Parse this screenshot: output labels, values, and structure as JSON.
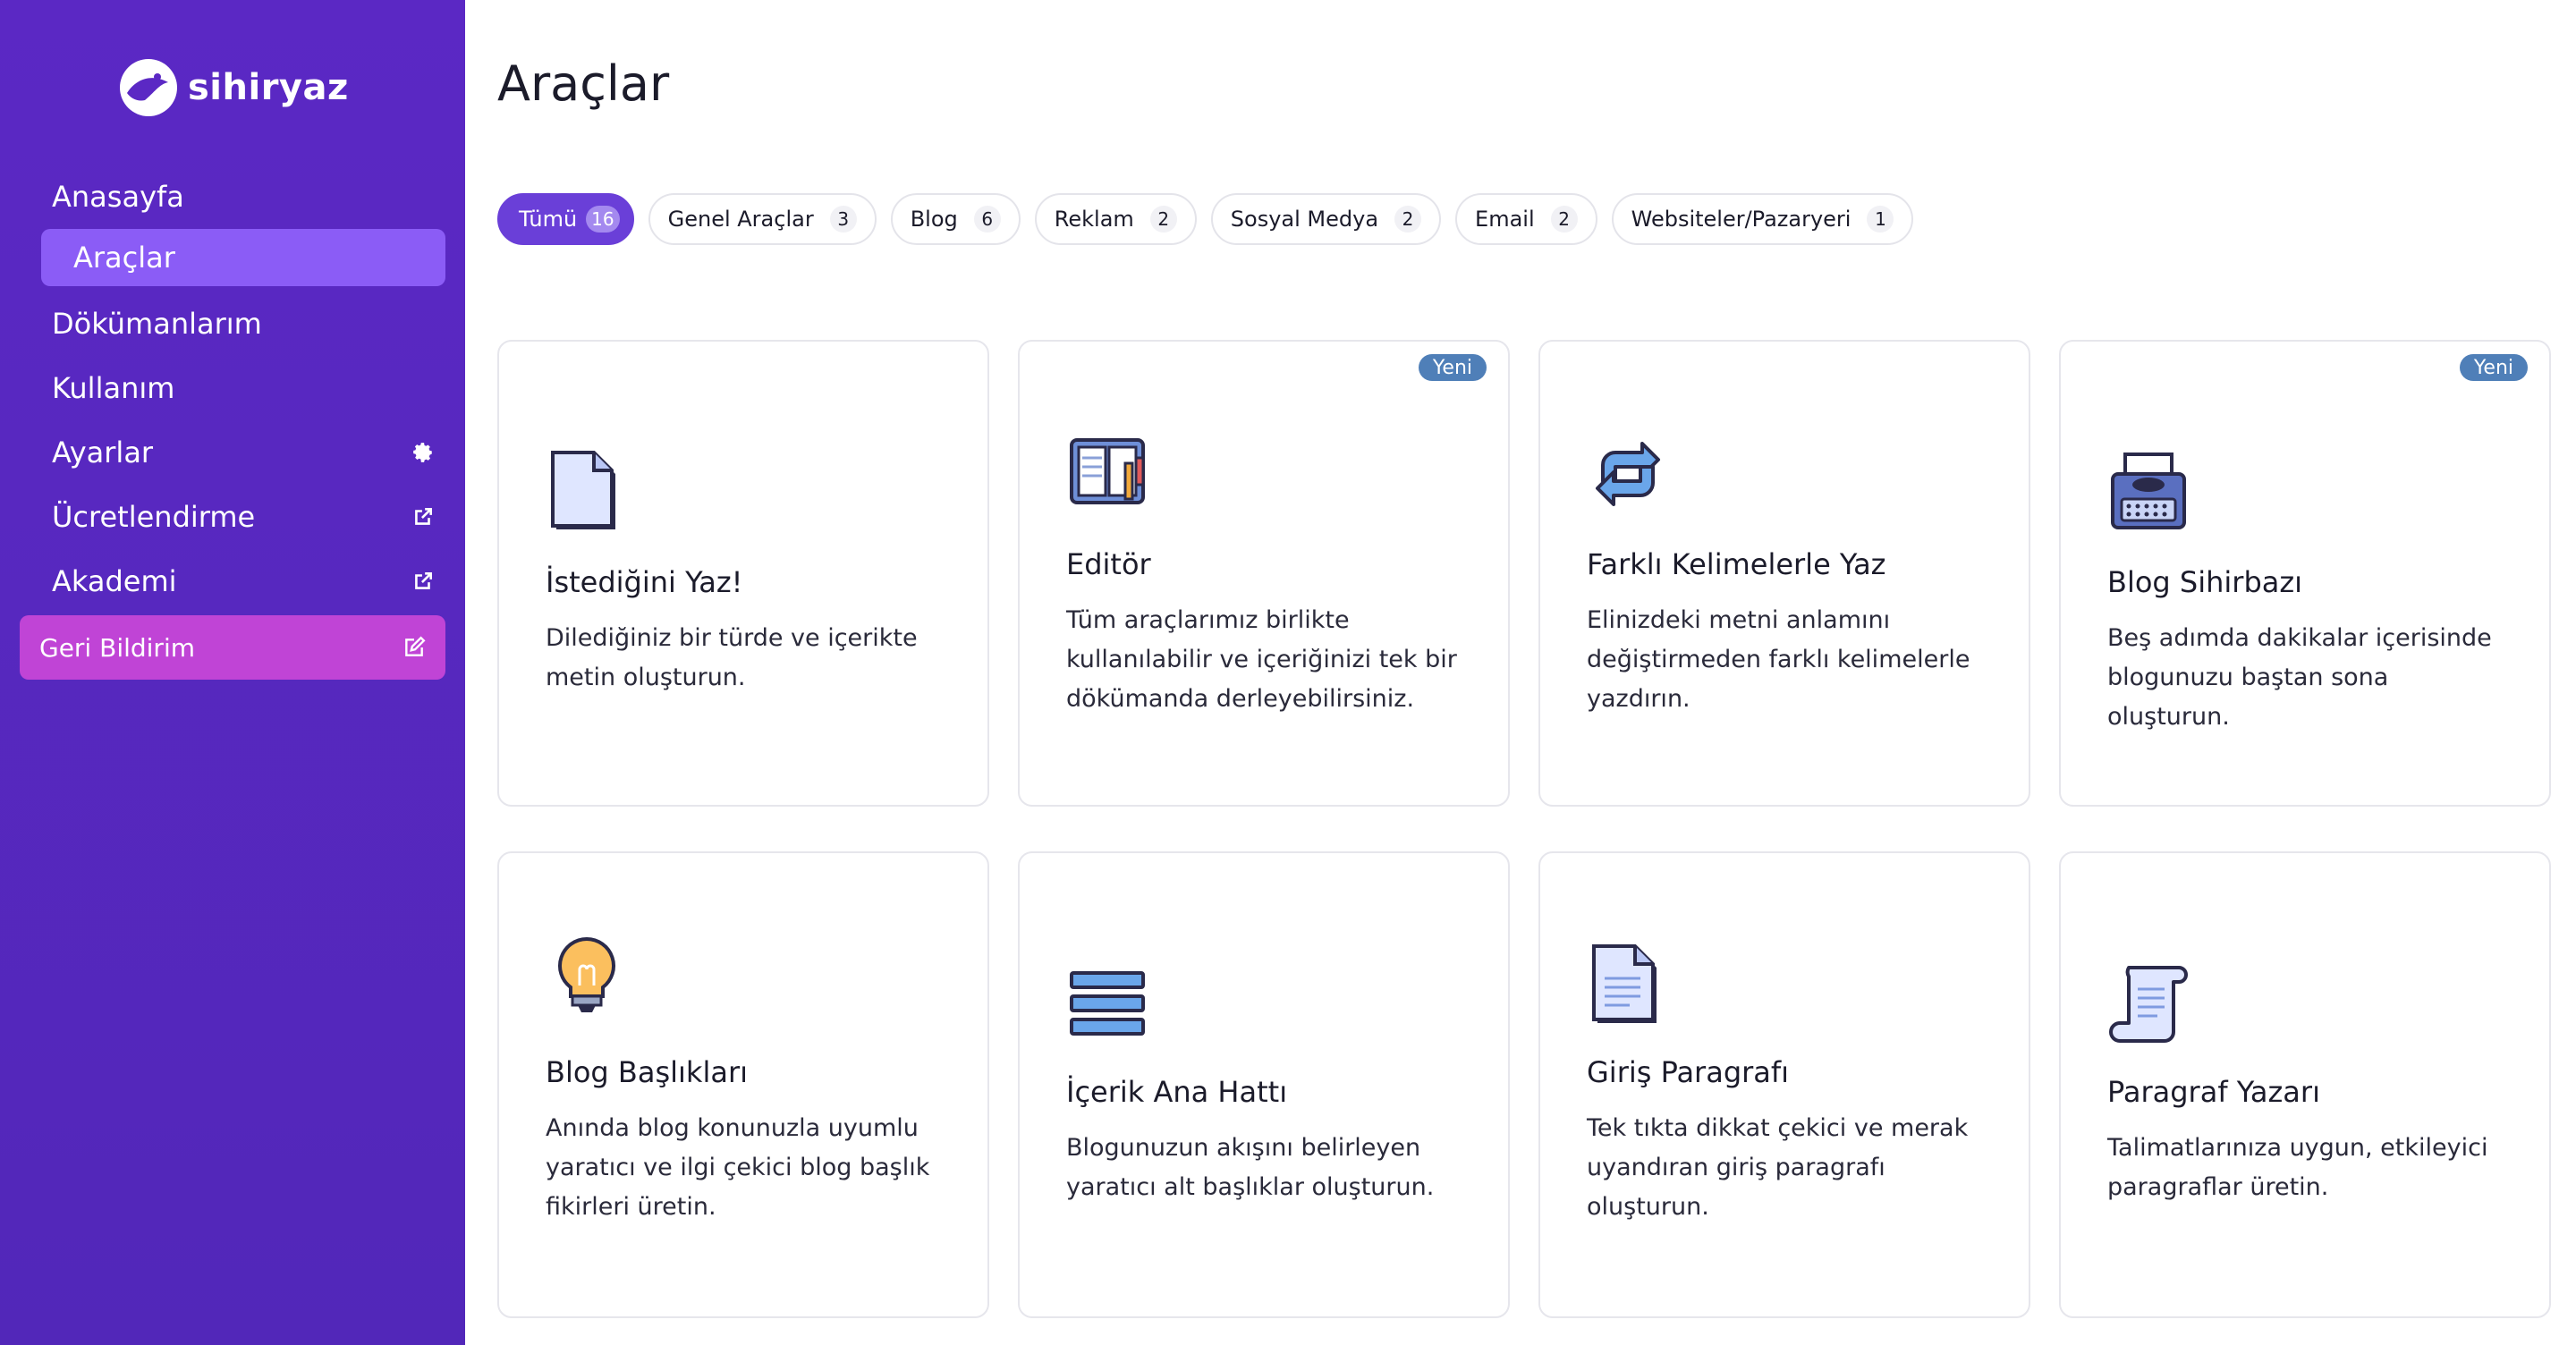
{
  "brand": {
    "name": "sihiryaz"
  },
  "sidebar": {
    "items": [
      {
        "label": "Anasayfa",
        "icon": ""
      },
      {
        "label": "Araçlar",
        "icon": ""
      },
      {
        "label": "Dökümanlarım",
        "icon": ""
      },
      {
        "label": "Kullanım",
        "icon": ""
      },
      {
        "label": "Ayarlar",
        "icon": "gear-icon"
      },
      {
        "label": "Ücretlendirme",
        "icon": "external-link-icon"
      },
      {
        "label": "Akademi",
        "icon": "external-link-icon"
      }
    ],
    "feedback": {
      "label": "Geri Bildirim",
      "icon": "edit-icon"
    }
  },
  "page": {
    "title": "Araçlar"
  },
  "filters": [
    {
      "label": "Tümü",
      "count": "16"
    },
    {
      "label": "Genel Araçlar",
      "count": "3"
    },
    {
      "label": "Blog",
      "count": "6"
    },
    {
      "label": "Reklam",
      "count": "2"
    },
    {
      "label": "Sosyal Medya",
      "count": "2"
    },
    {
      "label": "Email",
      "count": "2"
    },
    {
      "label": "Websiteler/Pazaryeri",
      "count": "1"
    }
  ],
  "cards": [
    {
      "title": "İstediğini Yaz!",
      "desc": "Dilediğiniz bir türde ve içerikte metin oluşturun.",
      "badge": "",
      "icon": "document-icon"
    },
    {
      "title": "Editör",
      "desc": "Tüm araçlarımız birlikte kullanılabilir ve içeriğinizi tek bir dökümanda derleyebilirsiniz.",
      "badge": "Yeni",
      "icon": "notebook-icon"
    },
    {
      "title": "Farklı Kelimelerle Yaz",
      "desc": "Elinizdeki metni anlamını değiştirmeden farklı kelimelerle yazdırın.",
      "badge": "",
      "icon": "repeat-icon"
    },
    {
      "title": "Blog Sihirbazı",
      "desc": "Beş adımda dakikalar içerisinde blogunuzu baştan sona oluşturun.",
      "badge": "Yeni",
      "icon": "typewriter-icon"
    },
    {
      "title": "Blog Başlıkları",
      "desc": "Anında blog konunuzla uyumlu yaratıcı ve ilgi çekici blog başlık fikirleri üretin.",
      "badge": "",
      "icon": "lightbulb-icon"
    },
    {
      "title": "İçerik Ana Hattı",
      "desc": "Blogunuzun akışını belirleyen yaratıcı alt başlıklar oluşturun.",
      "badge": "",
      "icon": "list-icon"
    },
    {
      "title": "Giriş Paragrafı",
      "desc": "Tek tıkta dikkat çekici ve merak uyandıran giriş paragrafı oluşturun.",
      "badge": "",
      "icon": "text-document-icon"
    },
    {
      "title": "Paragraf Yazarı",
      "desc": "Talimatlarınıza uygun, etkileyici paragraflar üretin.",
      "badge": "",
      "icon": "scroll-icon"
    }
  ],
  "colors": {
    "sidebar": "#5b28c4",
    "active_nav": "#8b5cf6",
    "feedback": "#c044d6",
    "chip_active": "#6a3fd8",
    "badge": "#4f7fb8"
  }
}
